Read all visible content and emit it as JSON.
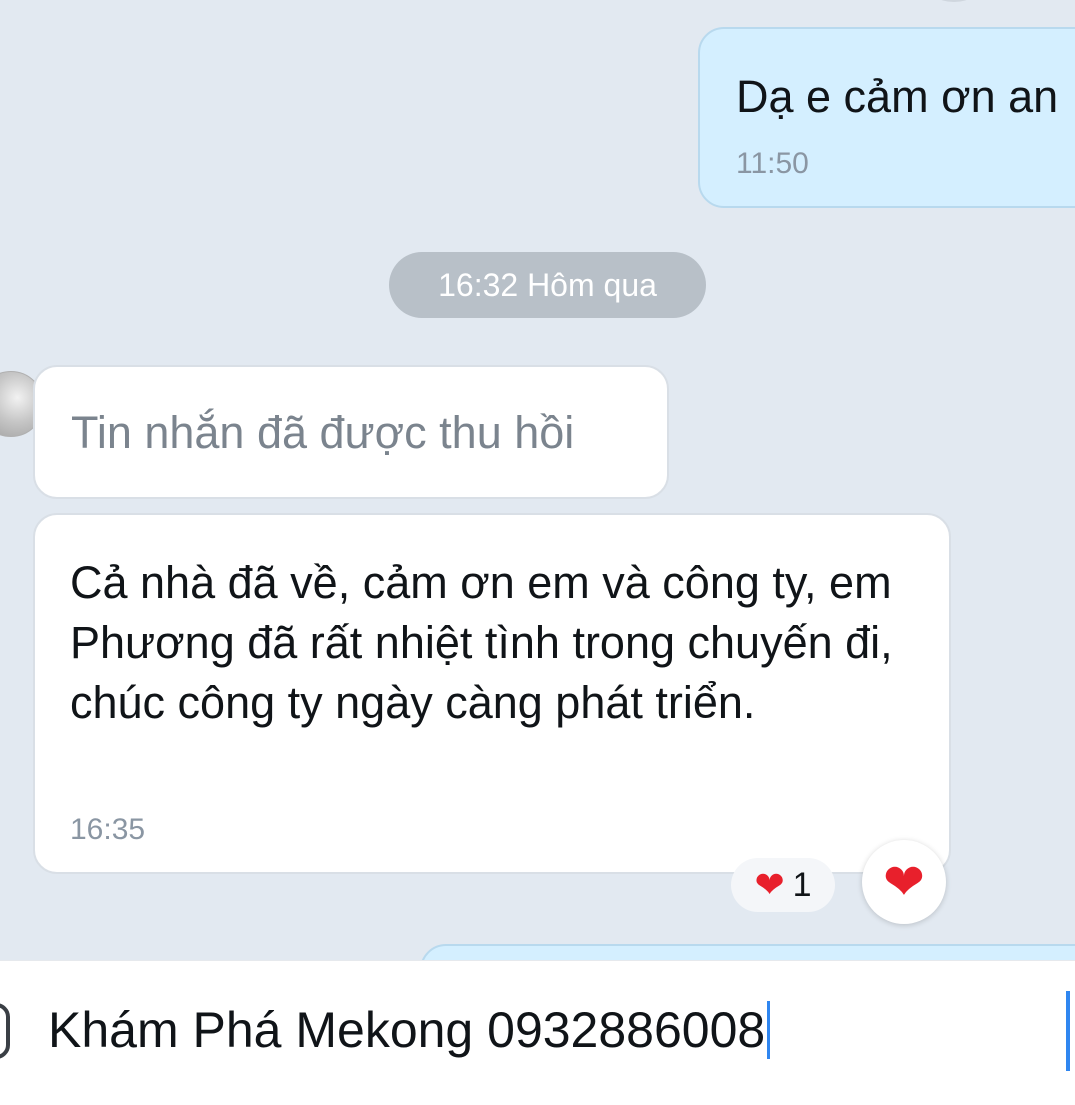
{
  "conversation": {
    "outgoing_message": {
      "text": "Dạ e cảm ơn an",
      "time": "11:50"
    },
    "date_separator": "16:32 Hôm qua",
    "recalled_message": {
      "text": "Tin nhắn đã được thu hồi"
    },
    "incoming_message": {
      "text": "Cả nhà đã về, cảm ơn em và công ty, em Phương đã rất nhiệt tình trong chuyến đi, chúc công ty ngày càng phát triển.",
      "time": "16:35",
      "reaction_icon": "heart",
      "reaction_count": "1"
    }
  },
  "composer": {
    "input_value": "Khám Phá Mekong 0932886008",
    "react_button_icon": "heart"
  },
  "colors": {
    "background": "#e2e9f1",
    "outgoing_bubble": "#d4efff",
    "incoming_bubble": "#ffffff",
    "date_pill": "#b8c0c8",
    "heart": "#e8202c",
    "caret": "#2f86f0"
  }
}
